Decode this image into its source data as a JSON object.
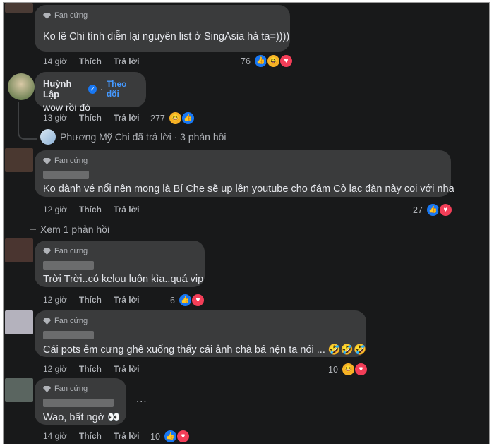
{
  "badge_label": "Fan cứng",
  "comments": [
    {
      "text": "Ko lẽ Chi tính diễn lại nguyên list ở SingAsia hả ta=))))",
      "time": "14 giờ",
      "like": "Thích",
      "reply": "Trả lời",
      "react_count": "76",
      "reactions": [
        "like-icon",
        "haha-icon",
        "love-icon"
      ]
    },
    {
      "name": "Huỳnh Lập",
      "follow": "Theo dõi",
      "separator": "·",
      "text": "wow rồi đó",
      "time": "13 giờ",
      "like": "Thích",
      "reply": "Trả lời",
      "react_count": "277",
      "reactions": [
        "haha-icon",
        "like-icon"
      ]
    },
    {
      "text": "Ko dành vé nổi nên mong là Bí Che sẽ up lên youtube cho đám Cò lạc đàn này coi với nha",
      "time": "12 giờ",
      "like": "Thích",
      "reply": "Trả lời",
      "react_count": "27",
      "reactions": [
        "like-icon",
        "love-icon"
      ]
    },
    {
      "text": "Trời Trời..có kelou luôn kìa..quá vip",
      "time": "12 giờ",
      "like": "Thích",
      "reply": "Trả lời",
      "react_count": "6",
      "reactions": [
        "like-icon",
        "love-icon"
      ]
    },
    {
      "text": "Cái pots ẻm cưng ghê xuống thấy cái ảnh chà bá nện ta nói ... 🤣🤣🤣",
      "time": "12 giờ",
      "like": "Thích",
      "reply": "Trả lời",
      "react_count": "10",
      "reactions": [
        "haha-icon",
        "love-icon"
      ]
    },
    {
      "text": "Wao, bất ngờ 👀",
      "time": "14 giờ",
      "like": "Thích",
      "reply": "Trả lời",
      "react_count": "10",
      "reactions": [
        "like-icon",
        "love-icon"
      ],
      "more": "..."
    }
  ],
  "replies_summary": "Phương Mỹ Chi đã trả lời · 3 phản hồi",
  "see_more_replies": "Xem 1 phản hồi",
  "colors": {
    "background": "#18191a",
    "bubble": "#3a3b3c",
    "text": "#e4e6eb",
    "muted": "#b0b3b8",
    "link": "#4599ff",
    "like": "#1877f2",
    "love": "#f33e58",
    "haha": "#f7b125"
  }
}
